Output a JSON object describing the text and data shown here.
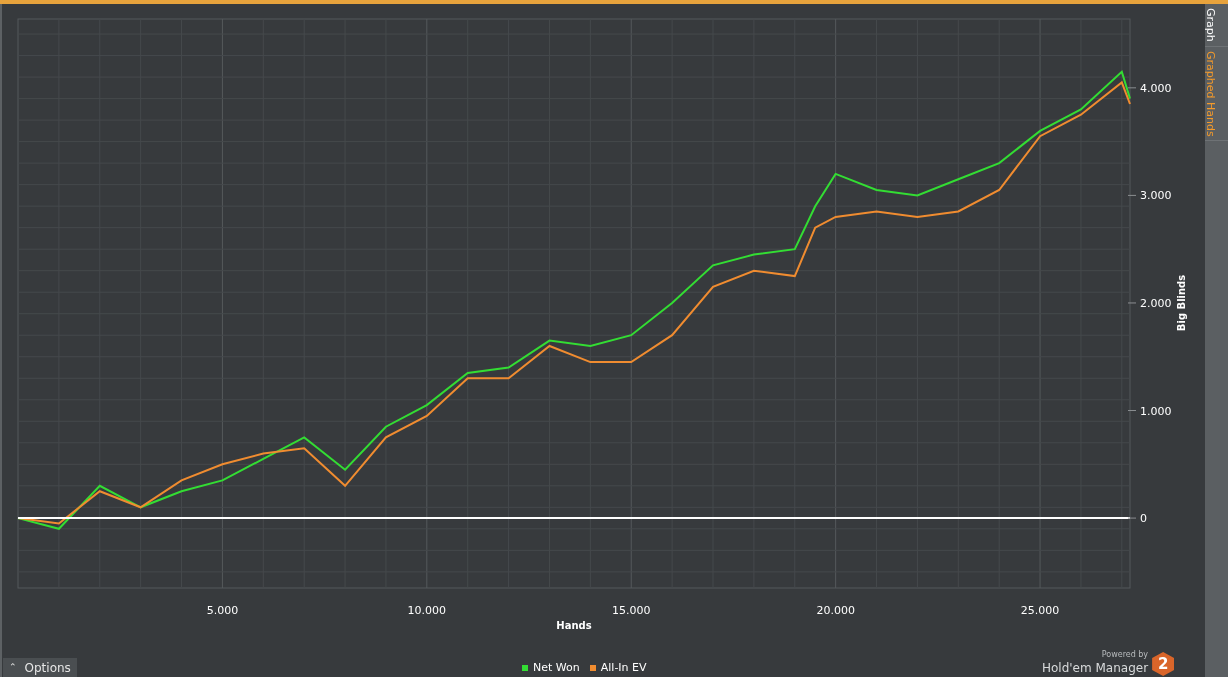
{
  "side_tabs": [
    {
      "label": "Graph",
      "selected": false
    },
    {
      "label": "Graphed Hands",
      "selected": true
    }
  ],
  "chart": {
    "chart_data": {
      "type": "line",
      "grid": true,
      "xlabel": "Hands",
      "ylabel": "Big Blinds",
      "xlim": [
        0,
        27200
      ],
      "ylim": [
        -650,
        4640
      ],
      "xticks": [
        {
          "value": 5000,
          "label": "5.000"
        },
        {
          "value": 10000,
          "label": "10.000"
        },
        {
          "value": 15000,
          "label": "15.000"
        },
        {
          "value": 20000,
          "label": "20.000"
        },
        {
          "value": 25000,
          "label": "25.000"
        }
      ],
      "yticks": [
        {
          "value": 0,
          "label": "0"
        },
        {
          "value": 1000,
          "label": "1.000"
        },
        {
          "value": 2000,
          "label": "2.000"
        },
        {
          "value": 3000,
          "label": "3.000"
        },
        {
          "value": 4000,
          "label": "4.000"
        }
      ],
      "x": [
        0,
        1000,
        2000,
        3000,
        4000,
        5000,
        6000,
        7000,
        8000,
        9000,
        10000,
        11000,
        12000,
        13000,
        14000,
        15000,
        16000,
        17000,
        18000,
        19000,
        19500,
        20000,
        21000,
        22000,
        23000,
        24000,
        25000,
        26000,
        27000,
        27200
      ],
      "series": [
        {
          "name": "Net Won",
          "color": "#33dd33",
          "values": [
            0,
            -100,
            300,
            100,
            250,
            350,
            550,
            750,
            450,
            850,
            1050,
            1350,
            1400,
            1650,
            1600,
            1700,
            2000,
            2350,
            2450,
            2500,
            2900,
            3200,
            3050,
            3000,
            3150,
            3300,
            3600,
            3800,
            4150,
            3900
          ]
        },
        {
          "name": "All-In EV",
          "color": "#f08c30",
          "values": [
            0,
            -50,
            250,
            100,
            350,
            500,
            600,
            650,
            300,
            750,
            950,
            1300,
            1300,
            1600,
            1450,
            1450,
            1700,
            2150,
            2300,
            2250,
            2700,
            2800,
            2850,
            2800,
            2850,
            3050,
            3550,
            3750,
            4050,
            3850
          ]
        }
      ]
    }
  },
  "options_button": {
    "icon": "⌃",
    "label": "Options"
  },
  "branding": {
    "caption": "Powered by",
    "product": "Hold'em Manager",
    "badge": "2"
  }
}
